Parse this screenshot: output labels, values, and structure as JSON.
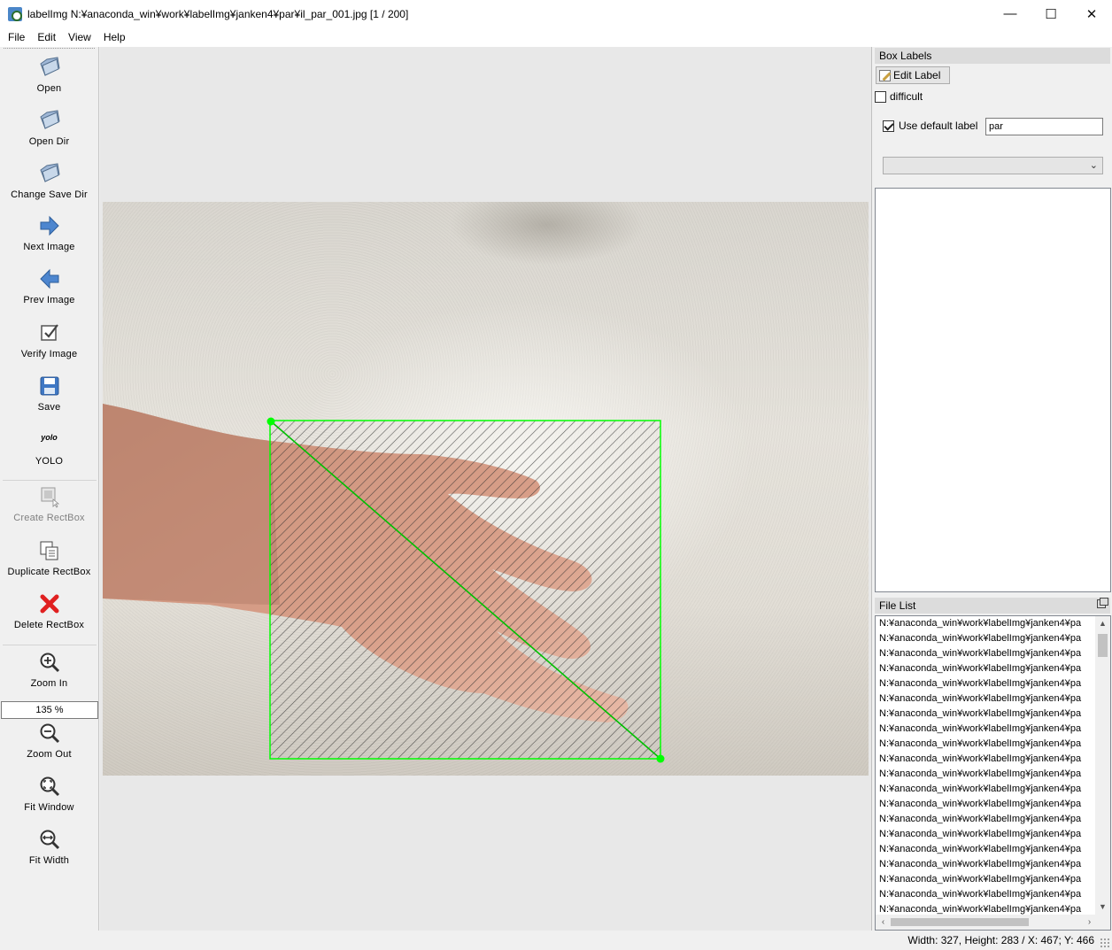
{
  "window": {
    "title": "labelImg N:¥anaconda_win¥work¥labelImg¥janken4¥par¥il_par_001.jpg [1 / 200]",
    "minimize": "—",
    "maximize": "☐",
    "close": "✕"
  },
  "menu": {
    "file": "File",
    "edit": "Edit",
    "view": "View",
    "help": "Help"
  },
  "toolbar": {
    "open": "Open",
    "open_dir": "Open Dir",
    "change_save_dir": "Change Save Dir",
    "next_image": "Next Image",
    "prev_image": "Prev Image",
    "verify_image": "Verify Image",
    "save": "Save",
    "yolo_icon_text": "yolo",
    "yolo": "YOLO",
    "create_rectbox": "Create RectBox",
    "duplicate_rectbox": "Duplicate RectBox",
    "delete_rectbox": "Delete RectBox",
    "zoom_in": "Zoom In",
    "zoom_value": "135 %",
    "zoom_out": "Zoom Out",
    "fit_window": "Fit Window",
    "fit_width": "Fit Width"
  },
  "box_labels": {
    "title": "Box Labels",
    "edit_label": "Edit Label",
    "difficult": "difficult",
    "difficult_checked": false,
    "use_default_label": "Use default label",
    "use_default_label_checked": true,
    "default_label_value": "par",
    "combo_value": ""
  },
  "file_list": {
    "title": "File List",
    "items": [
      "N:¥anaconda_win¥work¥labelImg¥janken4¥pa",
      "N:¥anaconda_win¥work¥labelImg¥janken4¥pa",
      "N:¥anaconda_win¥work¥labelImg¥janken4¥pa",
      "N:¥anaconda_win¥work¥labelImg¥janken4¥pa",
      "N:¥anaconda_win¥work¥labelImg¥janken4¥pa",
      "N:¥anaconda_win¥work¥labelImg¥janken4¥pa",
      "N:¥anaconda_win¥work¥labelImg¥janken4¥pa",
      "N:¥anaconda_win¥work¥labelImg¥janken4¥pa",
      "N:¥anaconda_win¥work¥labelImg¥janken4¥pa",
      "N:¥anaconda_win¥work¥labelImg¥janken4¥pa",
      "N:¥anaconda_win¥work¥labelImg¥janken4¥pa",
      "N:¥anaconda_win¥work¥labelImg¥janken4¥pa",
      "N:¥anaconda_win¥work¥labelImg¥janken4¥pa",
      "N:¥anaconda_win¥work¥labelImg¥janken4¥pa",
      "N:¥anaconda_win¥work¥labelImg¥janken4¥pa",
      "N:¥anaconda_win¥work¥labelImg¥janken4¥pa",
      "N:¥anaconda_win¥work¥labelImg¥janken4¥pa",
      "N:¥anaconda_win¥work¥labelImg¥janken4¥pa",
      "N:¥anaconda_win¥work¥labelImg¥janken4¥pa",
      "N:¥anaconda_win¥work¥labelImg¥janken4¥pa"
    ]
  },
  "status": {
    "text": "Width: 327, Height: 283 / X: 467; Y: 466"
  },
  "colors": {
    "bbox_stroke": "#00ff00",
    "bbox_vertex": "#00ff00",
    "bbox_hatch": "#2a2a2a",
    "accent_arrow": "#3c78c8",
    "delete_red": "#e02020"
  }
}
